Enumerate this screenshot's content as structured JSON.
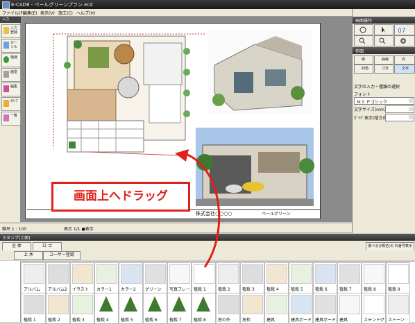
{
  "window": {
    "title": "E-CAD8 - ペールグリーンプラン.ecd"
  },
  "menu": [
    "ファイル(F)",
    "編集(E)",
    "表示(V)",
    "施工(C)",
    "ヘルプ(H)"
  ],
  "left_toolbar": {
    "header": "入力",
    "buttons": [
      "入力 登録",
      "カーソル",
      "植栽",
      "面塗",
      "編集",
      "ｽﾀﾝﾌﾟ",
      "一覧"
    ]
  },
  "canvas": {
    "company_label": "株式会社○○○○",
    "drawing_label": "ペールグリーン"
  },
  "statusbar": {
    "left": "縮尺 1 : 100",
    "right": "表示 1/1 ●表示"
  },
  "right_panel": {
    "section1": "画面操作",
    "section2": "作図",
    "tools": [
      "線",
      "曲線",
      "円",
      "四角",
      "寸法",
      "文字"
    ],
    "text_prompt": "文字の入力・種類の選択",
    "font_label": "フォント",
    "font_value": "ＭＳ Ｐゴシック",
    "size_label": "文字サイズ(mm)",
    "size_value": "",
    "option_label": "ｶﾞｲﾄﾞ表示(縦方向)"
  },
  "stamp_panel": {
    "title": "スタンプ(上面)",
    "tab1": "全 体",
    "tab2": "ロ ゴ",
    "sub1": "上 木",
    "sub2": "ユーザー登録",
    "button_right": "選べる分類名(の 0)番号表示",
    "row1": [
      "アルバム",
      "アルバム2",
      "イラスト",
      "カラー1",
      "カラー2",
      "グリーン",
      "写真フレーム",
      "植栽 1",
      "植栽 2",
      "植栽 3",
      "植栽 4",
      "植栽 5",
      "植栽 6",
      "植栽 7",
      "植栽 8",
      "植栽 9"
    ],
    "row2": [
      "植栽 1",
      "植栽 2",
      "植栽 3",
      "植栽 4",
      "植栽 5",
      "植栽 6",
      "植栽 7",
      "植栽 8",
      "窓の外",
      "窓枠",
      "建具",
      "建具ボード",
      "建具ボード2",
      "建具",
      "ステンドグラス",
      "ストーン"
    ]
  },
  "callout": {
    "text": "画面上へドラッグ"
  },
  "colors": {
    "accent_red": "#e0201a",
    "panel": "#ece9d8",
    "titlebar": "#222222"
  }
}
